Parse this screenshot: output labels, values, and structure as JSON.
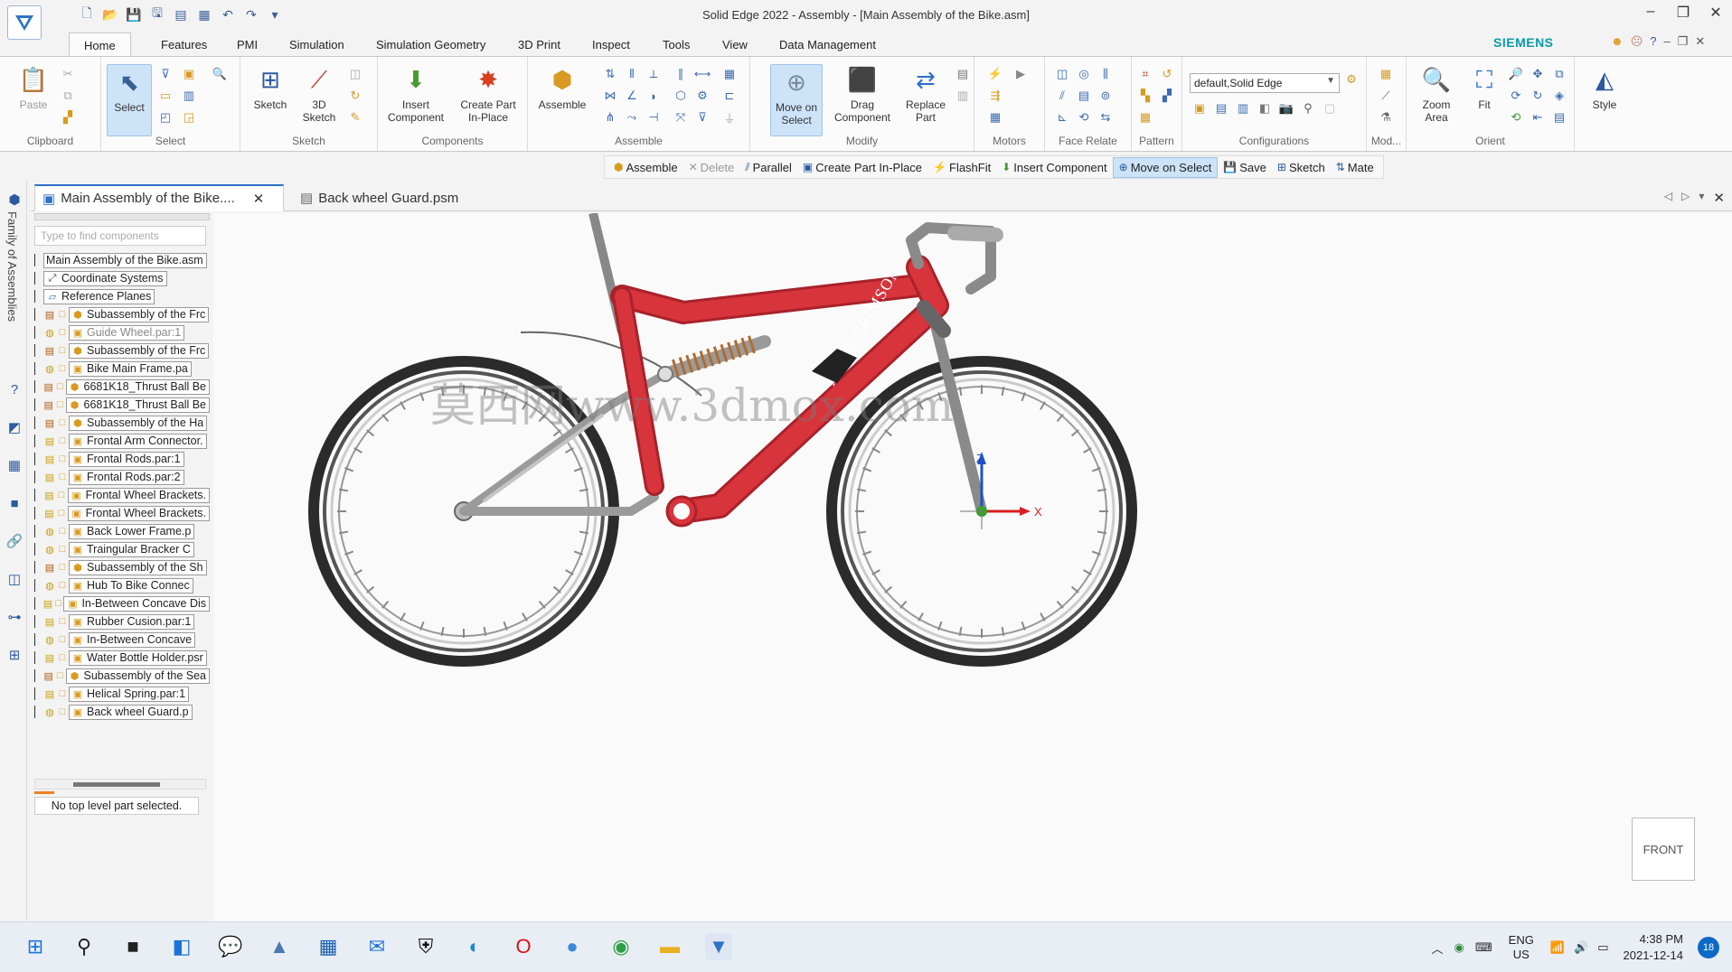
{
  "window": {
    "title": "Solid Edge 2022 - Assembly - [Main Assembly of the Bike.asm]"
  },
  "ribbon_tabs": [
    "Home",
    "Features",
    "PMI",
    "Simulation",
    "Simulation Geometry",
    "3D Print",
    "Inspect",
    "Tools",
    "View",
    "Data Management"
  ],
  "brand": "SIEMENS",
  "ribbon": {
    "groups": {
      "clipboard": "Clipboard",
      "select": "Select",
      "sketch": "Sketch",
      "components": "Components",
      "assemble": "Assemble",
      "modify": "Modify",
      "motors": "Motors",
      "face_relate": "Face Relate",
      "pattern": "Pattern",
      "configurations": "Configurations",
      "mod": "Mod...",
      "orient": "Orient"
    },
    "buttons": {
      "paste": "Paste",
      "select": "Select",
      "sketch": "Sketch",
      "sketch3d": "3D Sketch",
      "insert_component": "Insert Component",
      "create_part_inplace": "Create Part In-Place",
      "assemble": "Assemble",
      "move_on_select": "Move on Select",
      "drag_component": "Drag Component",
      "replace_part": "Replace Part",
      "zoom_area": "Zoom Area",
      "fit": "Fit",
      "style": "Style"
    },
    "configuration_value": "default,Solid Edge"
  },
  "command_bar": {
    "assemble": "Assemble",
    "delete": "Delete",
    "parallel": "Parallel",
    "create_part_inplace": "Create Part In-Place",
    "flashfit": "FlashFit",
    "insert_component": "Insert Component",
    "move_on_select": "Move on Select",
    "save": "Save",
    "sketch": "Sketch",
    "mate": "Mate"
  },
  "side_panel_title": "Family of Assemblies",
  "doc_tabs": {
    "main": "Main Assembly of the Bike....",
    "guard": "Back wheel Guard.psm"
  },
  "pathfinder": {
    "search_placeholder": "Type to find components",
    "root": "Main Assembly of the Bike.asm",
    "items": [
      {
        "label": "Coordinate Systems",
        "kind": "coord"
      },
      {
        "label": "Reference Planes",
        "kind": "plane"
      },
      {
        "label": "Subassembly of the Frc",
        "kind": "asm"
      },
      {
        "label": "Guide Wheel.par:1",
        "kind": "part2",
        "dim": true
      },
      {
        "label": "Subassembly of the Frc",
        "kind": "asm"
      },
      {
        "label": "Bike Main Frame.pa",
        "kind": "part2"
      },
      {
        "label": "6681K18_Thrust Ball Be",
        "kind": "asm"
      },
      {
        "label": "6681K18_Thrust Ball Be",
        "kind": "asm"
      },
      {
        "label": "Subassembly of the Ha",
        "kind": "asm"
      },
      {
        "label": "Frontal Arm Connector.",
        "kind": "part"
      },
      {
        "label": "Frontal Rods.par:1",
        "kind": "part"
      },
      {
        "label": "Frontal Rods.par:2",
        "kind": "part"
      },
      {
        "label": "Frontal Wheel Brackets.",
        "kind": "part"
      },
      {
        "label": "Frontal Wheel Brackets.",
        "kind": "part"
      },
      {
        "label": "Back Lower Frame.p",
        "kind": "part2"
      },
      {
        "label": "Traingular Bracker C",
        "kind": "part2"
      },
      {
        "label": "Subassembly of the Sh",
        "kind": "asm"
      },
      {
        "label": "Hub To Bike Connec",
        "kind": "part2"
      },
      {
        "label": "In-Between Concave Dis",
        "kind": "part"
      },
      {
        "label": "Rubber Cusion.par:1",
        "kind": "part"
      },
      {
        "label": "In-Between Concave",
        "kind": "part2"
      },
      {
        "label": "Water Bottle Holder.psr",
        "kind": "part"
      },
      {
        "label": "Subassembly of the Sea",
        "kind": "asm"
      },
      {
        "label": "Helical Spring.par:1",
        "kind": "part"
      },
      {
        "label": "Back wheel Guard.p",
        "kind": "part2"
      }
    ],
    "status": "No top level part selected."
  },
  "viewport": {
    "frame_text": "AERO-CRIMSON",
    "watermark": "莫西网www.3dmox.com",
    "axis_x": "X",
    "axis_z": "Z",
    "view_cube": "FRONT",
    "frame_color": "#d8343c"
  },
  "taskbar": {
    "lang_line1": "ENG",
    "lang_line2": "US",
    "time": "4:38 PM",
    "date": "2021-12-14",
    "notifications": "18"
  }
}
